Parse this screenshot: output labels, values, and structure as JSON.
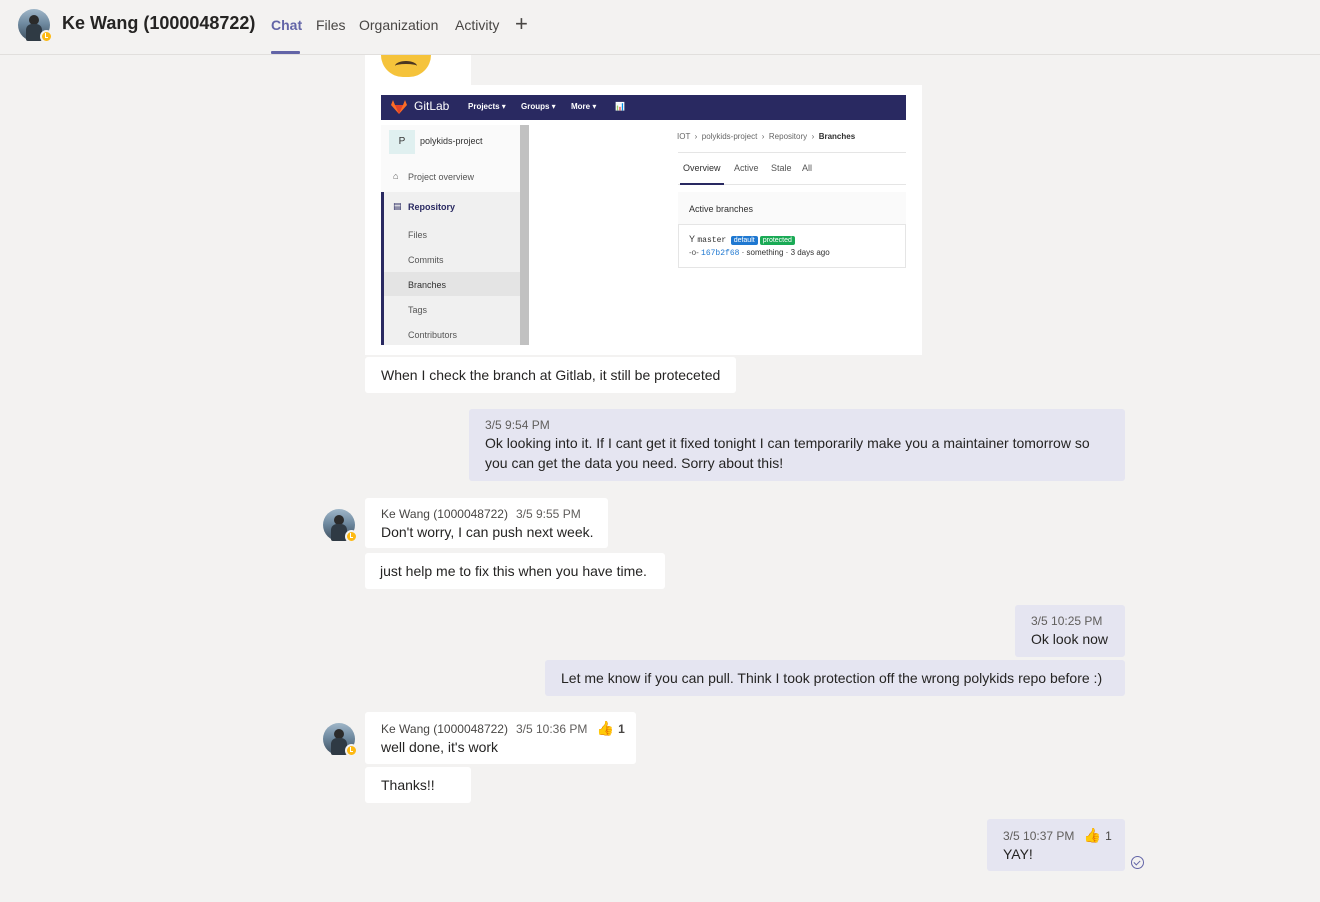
{
  "header": {
    "title": "Ke Wang (1000048722)",
    "tabs": [
      {
        "label": "Chat",
        "active": true
      },
      {
        "label": "Files",
        "active": false
      },
      {
        "label": "Organization",
        "active": false
      },
      {
        "label": "Activity",
        "active": false
      }
    ],
    "add_tab_icon": "+"
  },
  "gitlab_screenshot": {
    "brand": "GitLab",
    "nav": [
      "Projects ▾",
      "Groups ▾",
      "More ▾",
      "📊"
    ],
    "project_initial": "P",
    "project_name": "polykids-project",
    "sidebar": {
      "overview": "Project overview",
      "repository": "Repository",
      "items": [
        "Files",
        "Commits",
        "Branches",
        "Tags",
        "Contributors"
      ]
    },
    "breadcrumb": {
      "parts": [
        "IOT",
        "polykids-project",
        "Repository"
      ],
      "current": "Branches"
    },
    "tabs": [
      "Overview",
      "Active",
      "Stale",
      "All"
    ],
    "box_title": "Active branches",
    "branch": {
      "name": "master",
      "badges": [
        "default",
        "protected"
      ],
      "commit_sha": "167b2f68",
      "commit_info": "· something · 3 days ago"
    }
  },
  "messages": {
    "m1": {
      "text": "When I check the branch at Gitlab, it still be proteceted"
    },
    "m2": {
      "time": "3/5 9:54 PM",
      "line1": "Ok looking into it. If I cant get it fixed tonight I can temporarily make you a maintainer tomorrow so",
      "line2": "you can get the data you need. Sorry about this!"
    },
    "m3": {
      "author": "Ke Wang (1000048722)",
      "time": "3/5 9:55 PM",
      "text": "Don't worry, I can push next week."
    },
    "m4": {
      "text": "just help me to fix this when you have time."
    },
    "m5": {
      "time": "3/5 10:25 PM",
      "text": "Ok look now"
    },
    "m6": {
      "text": "Let me know if you can pull. Think I took protection off the wrong polykids repo before :)"
    },
    "m7": {
      "author": "Ke Wang (1000048722)",
      "time": "3/5 10:36 PM",
      "reaction_icon": "👍",
      "reaction_count": "1",
      "text": "well done, it's work"
    },
    "m8": {
      "text": "Thanks!!"
    },
    "m9": {
      "time": "3/5 10:37 PM",
      "reaction_icon": "👍",
      "reaction_count": "1",
      "text": "YAY!"
    }
  },
  "colors": {
    "accent": "#6264a7",
    "background": "#f3f2f1",
    "my_bubble": "#e5e5f1",
    "their_bubble": "#ffffff",
    "away_status": "#fdb913",
    "gitlab_nav": "#292961",
    "badge_default": "#1f78d1",
    "badge_protected": "#1aaa55"
  },
  "icons": {
    "avatar_status": "away-clock-icon",
    "read_receipt": "seen-check-icon",
    "reaction": "thumbs-up-icon"
  }
}
